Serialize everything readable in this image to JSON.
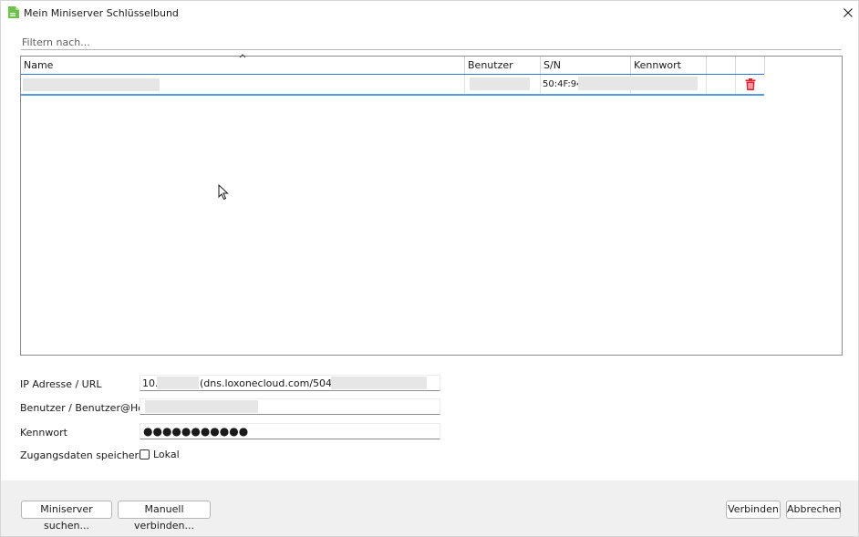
{
  "window": {
    "title": "Mein Miniserver Schlüsselbund",
    "icon": "green-document-icon",
    "close_icon": "close-icon"
  },
  "filter": {
    "placeholder": "Filtern nach...",
    "value": ""
  },
  "table": {
    "columns": [
      "Name",
      "Benutzer",
      "S/N",
      "Kennwort",
      "",
      ""
    ],
    "sorted_column": "Name",
    "sort_icon": "sort-arrow-up-icon",
    "rows": [
      {
        "name": "",
        "user": "",
        "sn": "50:4F:94:",
        "password": "",
        "delete_icon": "trash-icon"
      }
    ],
    "selection_color": "#5b9be0"
  },
  "form": {
    "ip_label": "IP Adresse / URL",
    "ip_value_start": "10.",
    "ip_value_middle": "(dns.loxonecloud.com/504F94",
    "user_label": "Benutzer / Benutzer@Host",
    "user_value": "",
    "password_label": "Kennwort",
    "password_value": "●●●●●●●●●●●",
    "save_label": "Zugangsdaten speichern:",
    "local_checkbox_label": "Lokal",
    "local_checked": false
  },
  "footer": {
    "search_button": "Miniserver suchen...",
    "manual_button": "Manuell verbinden...",
    "connect_button": "Verbinden",
    "cancel_button": "Abbrechen"
  },
  "colors": {
    "accent": "#2b7bd8",
    "delete": "#e0202f",
    "footer_bg": "#f0f0f0"
  }
}
